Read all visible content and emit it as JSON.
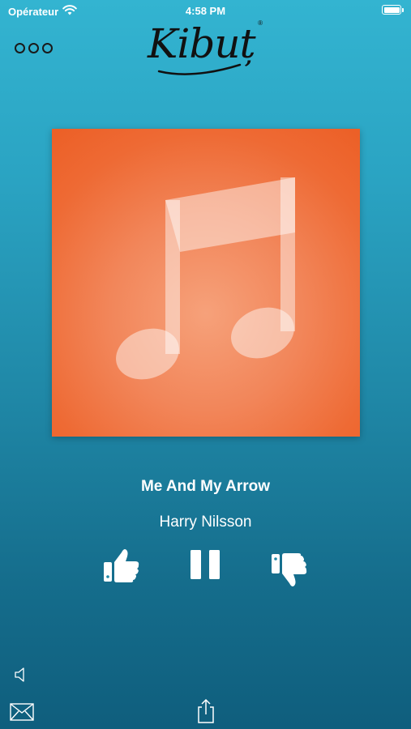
{
  "status_bar": {
    "carrier": "Opérateur",
    "time": "4:58 PM",
    "battery_level": 1.0
  },
  "header": {
    "logo_text": "Kibuț",
    "logo_mark": "®",
    "menu_icon": "three-circles-menu-icon"
  },
  "now_playing": {
    "artwork_icon": "music-note-icon",
    "artwork_color": "#ee6a34",
    "title": "Me And My Arrow",
    "artist": "Harry Nilsson"
  },
  "controls": {
    "like_icon": "thumbs-up-icon",
    "pause_icon": "pause-icon",
    "dislike_icon": "thumbs-down-icon"
  },
  "footer": {
    "volume_icon": "speaker-icon",
    "mail_icon": "envelope-icon",
    "share_icon": "share-icon"
  },
  "colors": {
    "background_top": "#33b4d1",
    "background_bottom": "#0f5e7d",
    "text": "#ffffff",
    "logo": "#111111"
  }
}
